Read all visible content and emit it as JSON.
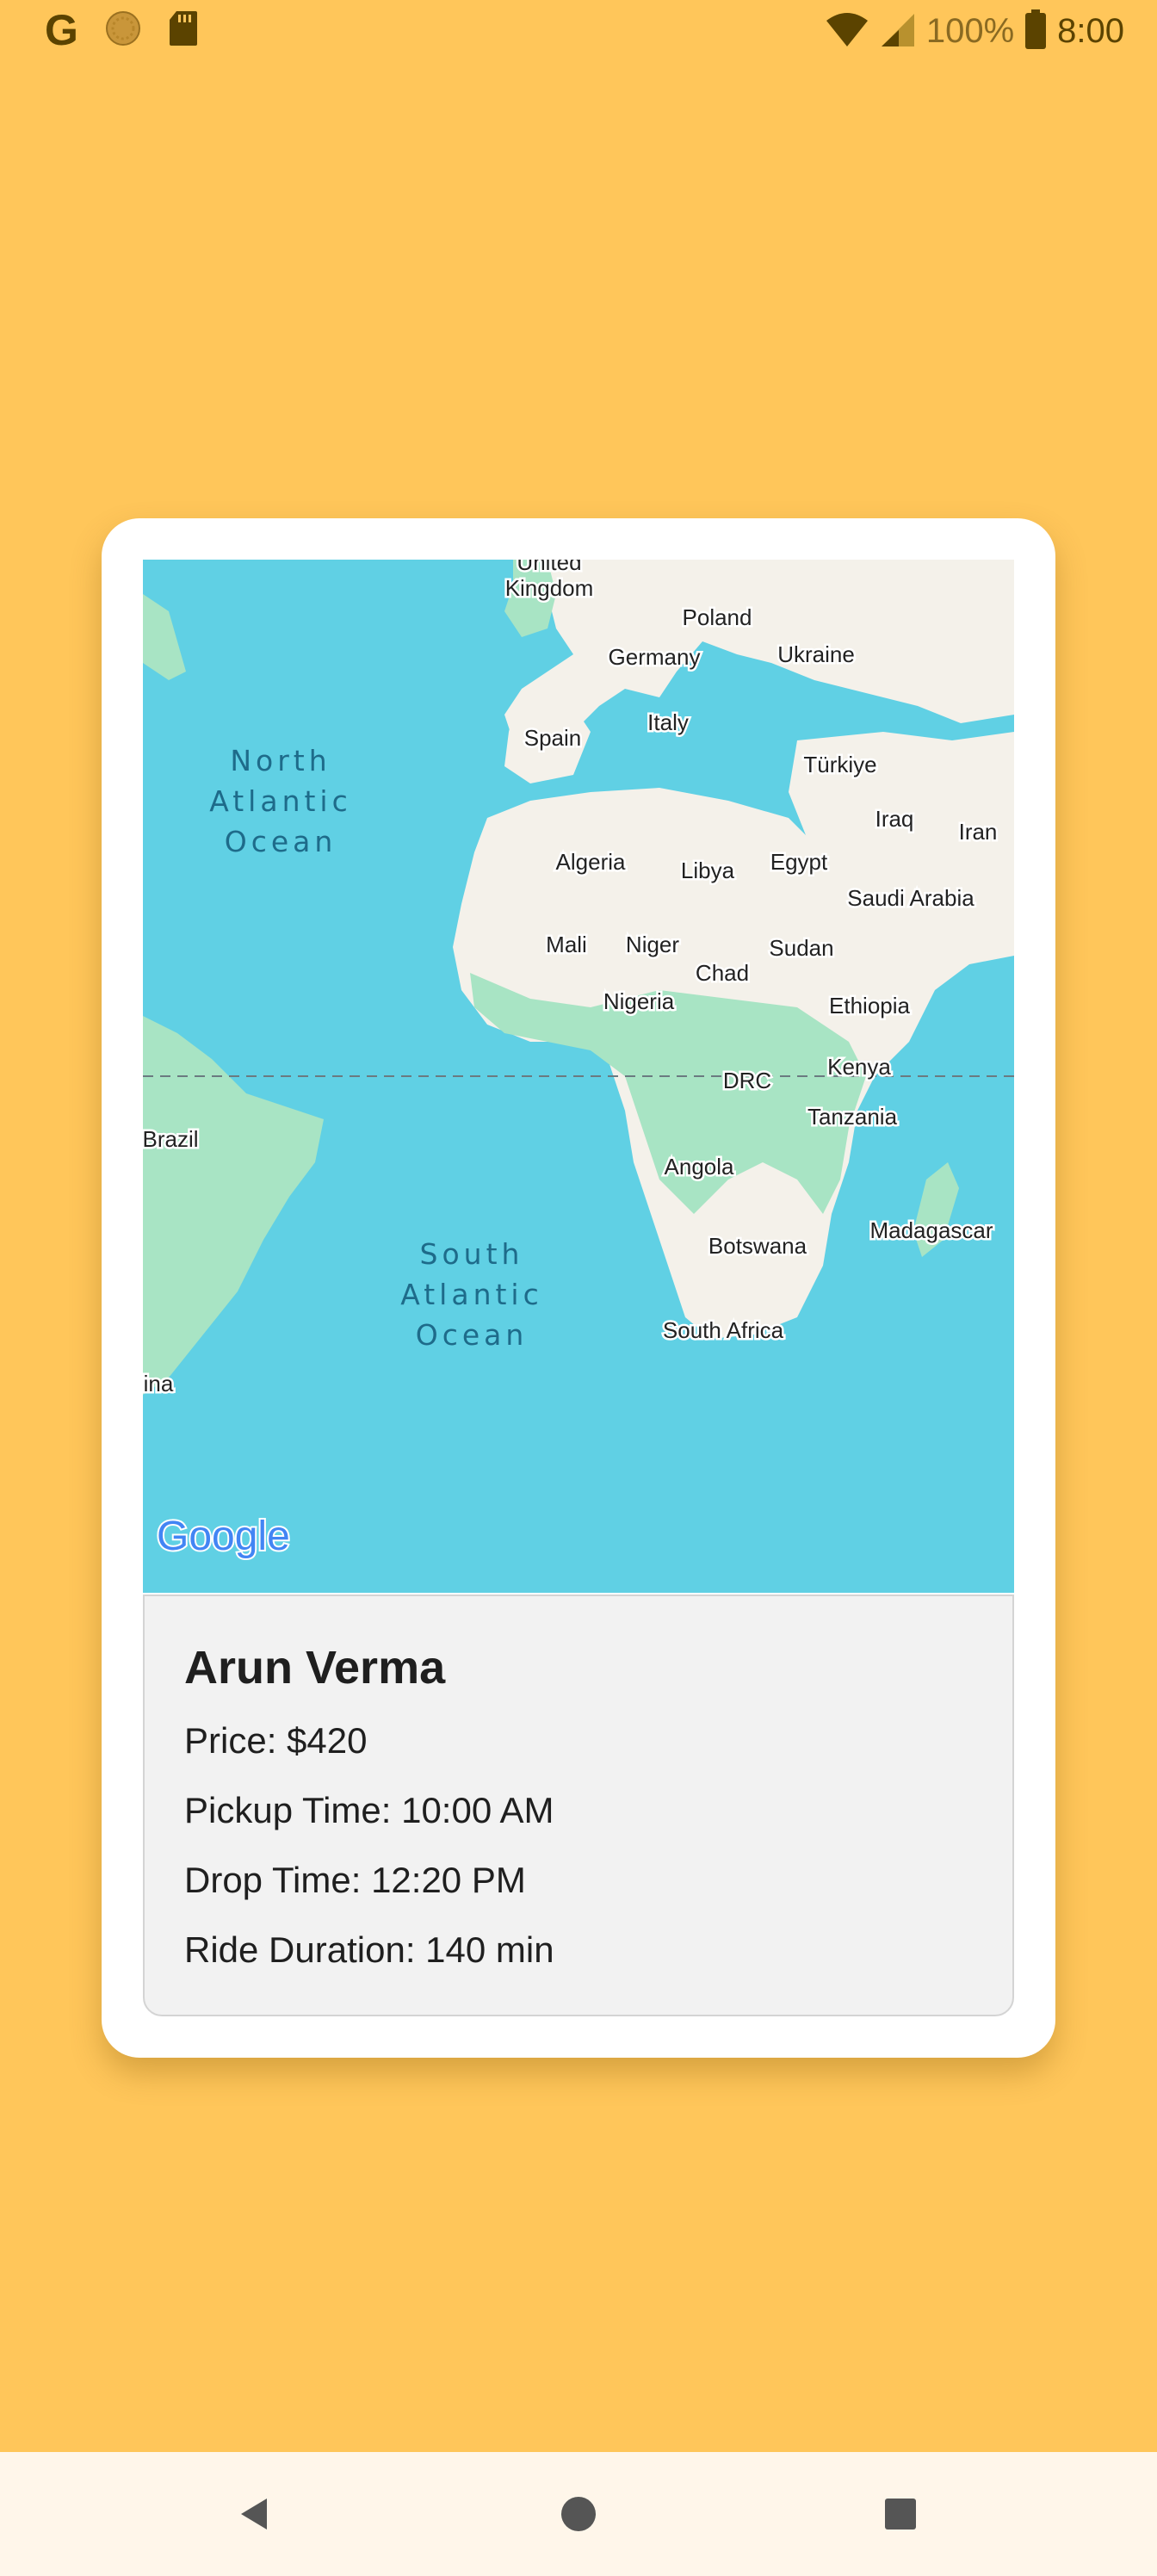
{
  "status_bar": {
    "left_icons": [
      "google-g-icon",
      "media-disc-icon",
      "sd-card-icon"
    ],
    "google_letter": "G",
    "wifi_icon": "wifi-icon",
    "signal_icon": "cell-signal-icon",
    "battery_percent": "100%",
    "battery_icon": "battery-icon",
    "time": "8:00"
  },
  "map": {
    "attribution": "Google",
    "oceans": [
      {
        "lines": [
          "North",
          "Atlantic",
          "Ocean"
        ]
      },
      {
        "lines": [
          "South",
          "Atlantic",
          "Ocean"
        ]
      }
    ],
    "countries": [
      "United Kingdom",
      "Poland",
      "Germany",
      "Ukraine",
      "Italy",
      "Spain",
      "Türkiye",
      "Iraq",
      "Iran",
      "Algeria",
      "Libya",
      "Egypt",
      "Saudi Arabia",
      "Mali",
      "Niger",
      "Sudan",
      "Chad",
      "Nigeria",
      "Ethiopia",
      "DRC",
      "Kenya",
      "Tanzania",
      "Brazil",
      "Angola",
      "Madagascar",
      "Botswana",
      "South Africa",
      "ina"
    ],
    "label_united": "United",
    "label_kingdom": "Kingdom"
  },
  "ride": {
    "driver_name": "Arun Verma",
    "price_label": "Price",
    "price_value": "$420",
    "pickup_label": "Pickup Time",
    "pickup_value": "10:00 AM",
    "drop_label": "Drop Time",
    "drop_value": "12:20 PM",
    "duration_label": "Ride Duration",
    "duration_value": "140 min"
  },
  "nav_bar": {
    "back": "back-icon",
    "home": "home-icon",
    "recents": "recents-icon"
  },
  "colors": {
    "background": "#FFC65A",
    "card": "#FFFFFF",
    "ocean": "#60D0E4",
    "land": "#F4F1EA",
    "vegetation": "#A8E4C4",
    "panel": "#F2F2F2"
  }
}
